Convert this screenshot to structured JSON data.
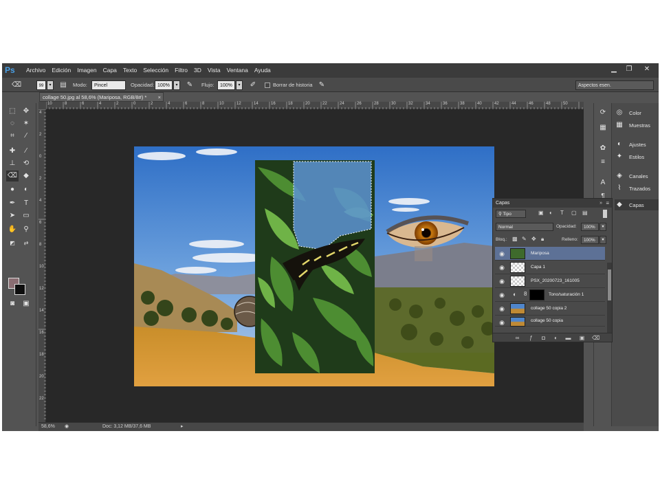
{
  "app": {
    "logo": "Ps",
    "accent": "#4aa0e6"
  },
  "menu": [
    "Archivo",
    "Edición",
    "Imagen",
    "Capa",
    "Texto",
    "Selección",
    "Filtro",
    "3D",
    "Vista",
    "Ventana",
    "Ayuda"
  ],
  "window_controls": {
    "minimize": "▁",
    "restore": "❐",
    "close": "✕"
  },
  "options": {
    "brush_size": "99",
    "mode_label": "Modo:",
    "mode_value": "Pincel",
    "opacity_label": "Opacidad:",
    "opacity_value": "100%",
    "flow_label": "Flujo:",
    "flow_value": "100%",
    "erase_history_label": "Borrar de historia",
    "workspace_value": "Aspectos esen."
  },
  "document": {
    "tab_title": "collage 50.jpg al 58,6% (Mariposa, RGB/8#) *",
    "tab_close": "×"
  },
  "rulers": {
    "horizontal": [
      "10",
      "8",
      "6",
      "4",
      "2",
      "0",
      "2",
      "4",
      "6",
      "8",
      "10",
      "12",
      "14",
      "16",
      "18",
      "20",
      "22",
      "24",
      "26",
      "28",
      "30",
      "32",
      "34",
      "36",
      "38",
      "40",
      "42",
      "44",
      "46",
      "48",
      "50"
    ],
    "vertical": [
      "4",
      "2",
      "0",
      "2",
      "4",
      "6",
      "8",
      "10",
      "12",
      "14",
      "16",
      "18",
      "20",
      "22"
    ]
  },
  "status": {
    "zoom": "58,6%",
    "doc": "Doc: 3,12 MB/37,6 MB"
  },
  "dock_entries": [
    {
      "label": "Color",
      "icon": "palette-icon"
    },
    {
      "label": "Muestras",
      "icon": "grid-icon"
    },
    {
      "label": "Ajustes",
      "icon": "circle-half-icon"
    },
    {
      "label": "Estilos",
      "icon": "fx-icon"
    },
    {
      "label": "Canales",
      "icon": "channels-icon"
    },
    {
      "label": "Trazados",
      "icon": "path-icon"
    },
    {
      "label": "Capas",
      "icon": "layers-icon"
    }
  ],
  "layers_panel": {
    "title": "Capas",
    "filter_label": "Tipo",
    "blend_mode": "Normal",
    "opacity_label": "Opacidad:",
    "opacity_value": "100%",
    "lock_label": "Bloq.:",
    "fill_label": "Relleno:",
    "fill_value": "100%",
    "layers": [
      {
        "name": "Mariposa",
        "selected": true
      },
      {
        "name": "Capa 1",
        "selected": false
      },
      {
        "name": "PSX_20200723_161005",
        "selected": false
      },
      {
        "name": "Tono/saturación 1",
        "selected": false
      },
      {
        "name": "collage 50 copia 2",
        "selected": false
      },
      {
        "name": "collage 50 copia",
        "selected": false
      }
    ]
  },
  "colors": {
    "foreground": "#8a6d72",
    "background": "#0d0d0d",
    "selected_layer": "#5d7196"
  }
}
